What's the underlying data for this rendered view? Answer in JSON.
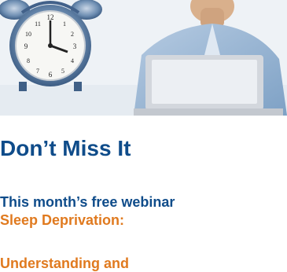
{
  "hero": {
    "image_name": "alarm-clock-and-person-at-laptop",
    "colors": {
      "sky": "#eef2f6",
      "clock_metal": "#6f8fb3",
      "shirt": "#9fbbd6",
      "skin": "#d9b08c"
    }
  },
  "content": {
    "title": "Don’t Miss It",
    "subtitle": "This month’s free webinar",
    "topic_line1": "Sleep Deprivation:",
    "topic_line2": "Understanding and"
  },
  "colors": {
    "title_blue": "#0f4c8a",
    "accent_orange": "#e07a1f"
  }
}
